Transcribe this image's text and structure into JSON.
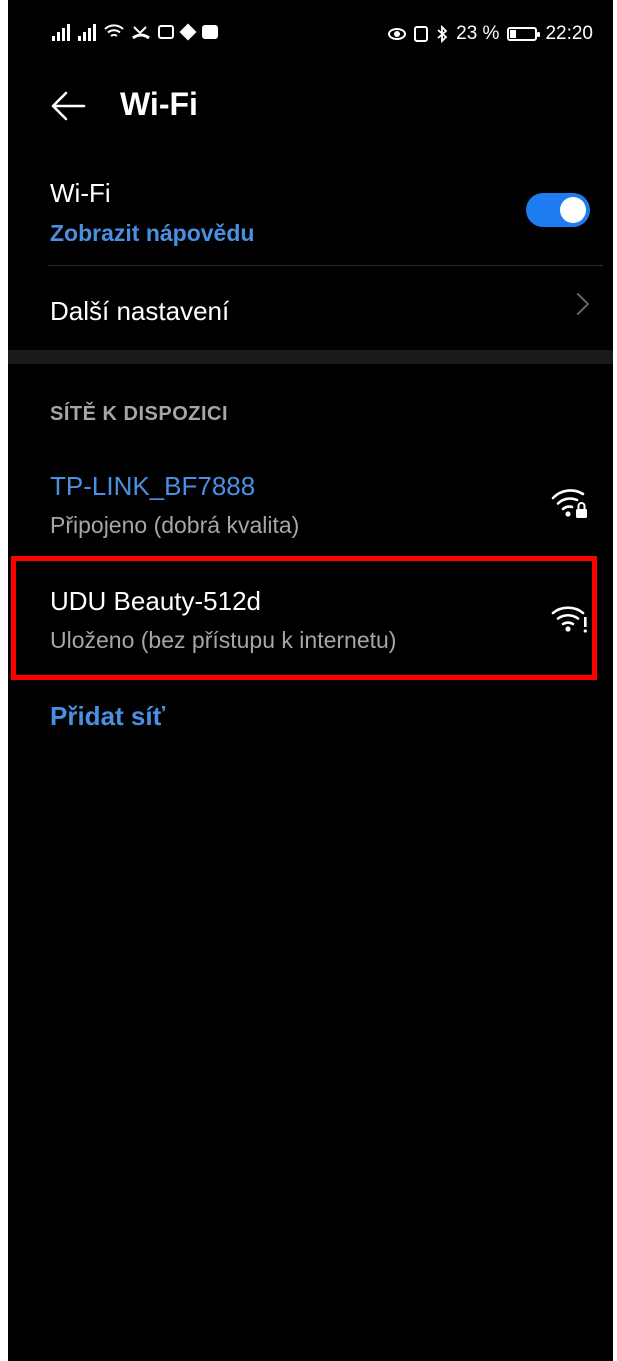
{
  "status_bar": {
    "battery_percent": "23 %",
    "time": "22:20"
  },
  "header": {
    "title": "Wi-Fi"
  },
  "wifi_toggle": {
    "label": "Wi-Fi",
    "help_link": "Zobrazit nápovědu",
    "enabled": true
  },
  "more_settings": {
    "label": "Další nastavení"
  },
  "available_section": {
    "title": "SÍTĚ K DISPOZICI"
  },
  "networks": [
    {
      "name": "TP-LINK_BF7888",
      "status": "Připojeno (dobrá kvalita)",
      "icon": "wifi-locked-icon",
      "name_color": "#4a90e2"
    },
    {
      "name": "UDU Beauty-512d",
      "status": "Uloženo (bez přístupu k internetu)",
      "icon": "wifi-no-internet-icon",
      "name_color": "#ffffff"
    }
  ],
  "add_network": {
    "label": "Přidat síť"
  },
  "colors": {
    "accent": "#1f7cf0",
    "link": "#4a90e2",
    "highlight": "#ff0000"
  }
}
